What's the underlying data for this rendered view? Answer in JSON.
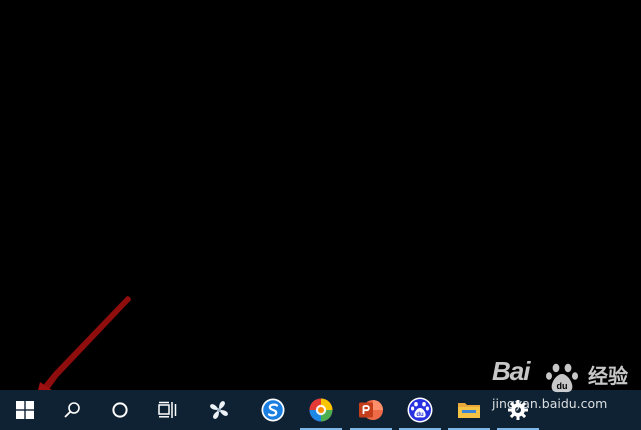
{
  "desktop": {
    "background_color": "#000000"
  },
  "annotation": {
    "type": "arrow",
    "color": "#a01010",
    "points_to": "start-button"
  },
  "taskbar": {
    "background_color": "#0f2233",
    "items": [
      {
        "name": "start-button",
        "icon": "windows-logo-icon",
        "running": false
      },
      {
        "name": "search-button",
        "icon": "search-icon",
        "running": false
      },
      {
        "name": "cortana-button",
        "icon": "cortana-circle-icon",
        "running": false
      },
      {
        "name": "task-view-button",
        "icon": "task-view-icon",
        "running": false
      },
      {
        "name": "app-pinwheel",
        "icon": "pinwheel-icon",
        "running": false
      },
      {
        "name": "app-sogou-browser",
        "icon": "sogou-s-icon",
        "running": false
      },
      {
        "name": "app-colorful-sphere",
        "icon": "colorful-ball-icon",
        "running": true
      },
      {
        "name": "app-powerpoint",
        "icon": "powerpoint-icon",
        "running": true
      },
      {
        "name": "app-baidu",
        "icon": "baidu-paw-icon",
        "running": true
      },
      {
        "name": "app-file-explorer",
        "icon": "folder-icon",
        "running": true
      },
      {
        "name": "app-settings",
        "icon": "gear-icon",
        "running": true
      }
    ],
    "indicator_color": "#7fb6e6"
  },
  "watermark": {
    "logo_text": "Bai",
    "logo_text_tail": "",
    "chinese_text": "经验",
    "url": "jingyan.baidu.com"
  }
}
